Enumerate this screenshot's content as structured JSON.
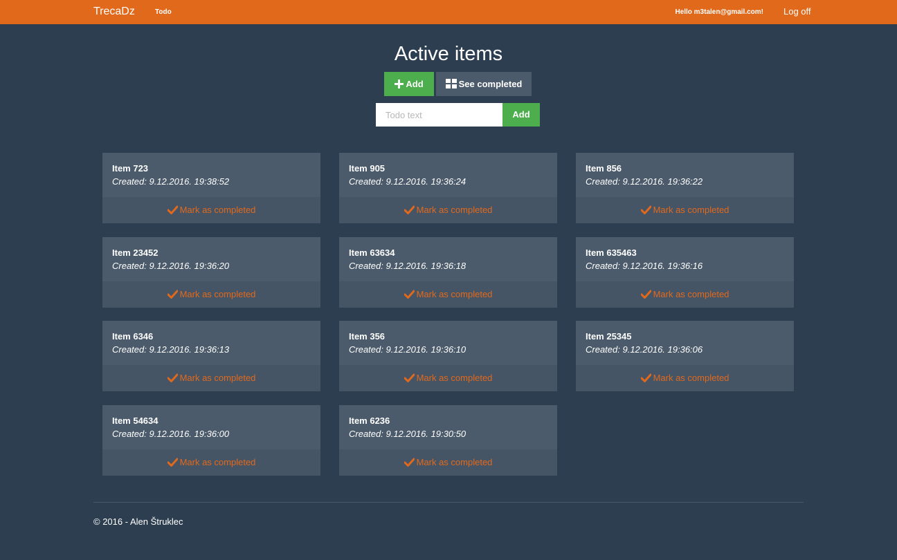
{
  "navbar": {
    "brand": "TrecaDz",
    "todo_link": "Todo",
    "hello": "Hello m3talen@gmail.com!",
    "logoff": "Log off"
  },
  "main": {
    "title": "Active items",
    "add_button": "Add",
    "see_completed_button": "See completed",
    "input_placeholder": "Todo text",
    "input_value": "",
    "submit_button": "Add",
    "mark_label": "Mark as completed"
  },
  "items": [
    {
      "title": "Item 723",
      "created": "Created: 9.12.2016. 19:38:52"
    },
    {
      "title": "Item 905",
      "created": "Created: 9.12.2016. 19:36:24"
    },
    {
      "title": "Item 856",
      "created": "Created: 9.12.2016. 19:36:22"
    },
    {
      "title": "Item 23452",
      "created": "Created: 9.12.2016. 19:36:20"
    },
    {
      "title": "Item 63634",
      "created": "Created: 9.12.2016. 19:36:18"
    },
    {
      "title": "Item 635463",
      "created": "Created: 9.12.2016. 19:36:16"
    },
    {
      "title": "Item 6346",
      "created": "Created: 9.12.2016. 19:36:13"
    },
    {
      "title": "Item 356",
      "created": "Created: 9.12.2016. 19:36:10"
    },
    {
      "title": "Item 25345",
      "created": "Created: 9.12.2016. 19:36:06"
    },
    {
      "title": "Item 54634",
      "created": "Created: 9.12.2016. 19:36:00"
    },
    {
      "title": "Item 6236",
      "created": "Created: 9.12.2016. 19:30:50"
    }
  ],
  "footer": {
    "text": "© 2016 - Alen Štruklec"
  },
  "colors": {
    "accent": "#e1691c",
    "background": "#2c3e50",
    "success": "#4cae4c",
    "card": "#4b5b6b"
  }
}
